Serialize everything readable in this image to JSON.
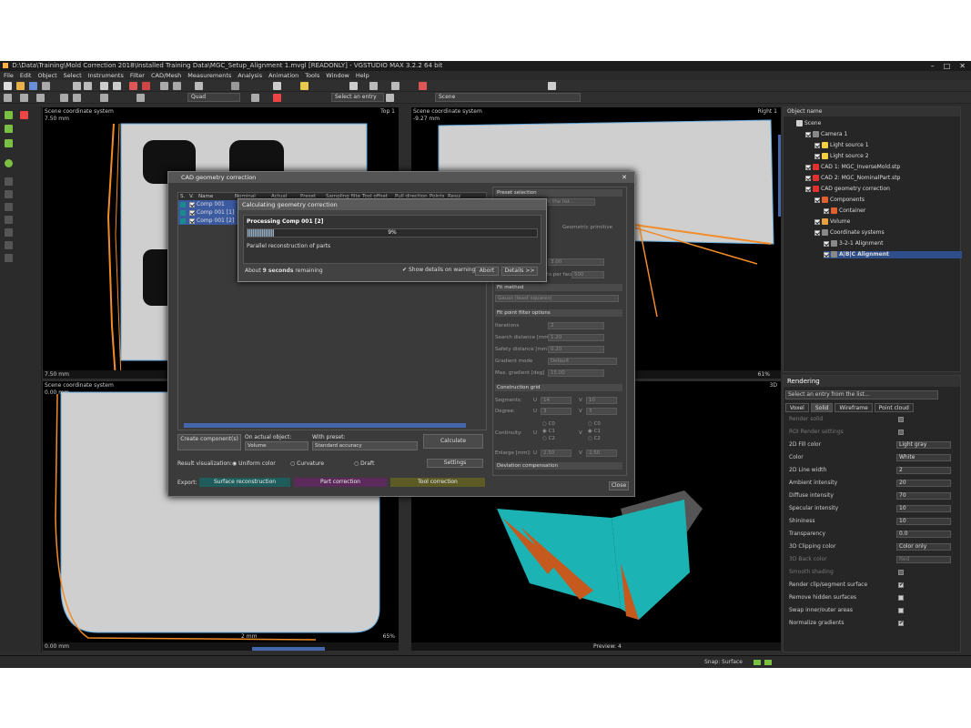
{
  "window": {
    "title": "D:\\Data\\Training\\Mold Correction 2018\\Installed Training Data\\MGC_Setup_Alignment 1.mvgl [READONLY] - VGSTUDIO MAX 3.2.2 64 bit"
  },
  "menu": [
    "File",
    "Edit",
    "Object",
    "Select",
    "Instruments",
    "Filter",
    "CAD/Mesh",
    "Measurements",
    "Analysis",
    "Animation",
    "Tools",
    "Window",
    "Help"
  ],
  "toolbar": {
    "quad_combo": "Quad",
    "entry_combo": "Select an entry",
    "scene_combo": "Scene"
  },
  "viewports": {
    "top_left": {
      "label": "Scene coordinate system",
      "value": "7.50 mm",
      "name": "Top 1",
      "footer_value": "7.50 mm"
    },
    "top_right": {
      "label": "Scene coordinate system",
      "value": "-9.27 mm",
      "name": "Right 1",
      "zoom": "61%"
    },
    "bottom_left": {
      "label": "Scene coordinate system",
      "value": "0.00 mm",
      "footer_value": "0.00 mm",
      "zoom": "65%",
      "scale": "2 mm"
    },
    "bottom_right": {
      "name": "3D",
      "preview": "Preview:",
      "preview_value": "4"
    }
  },
  "object_panel": {
    "header": "Object name",
    "items": [
      {
        "label": "Scene",
        "indent": 0
      },
      {
        "label": "Camera 1",
        "indent": 1
      },
      {
        "label": "Light source 1",
        "indent": 2
      },
      {
        "label": "Light source 2",
        "indent": 2
      },
      {
        "label": "CAD 1: MGC_InverseMold.stp",
        "indent": 1
      },
      {
        "label": "CAD 2: MGC_NominalPart.stp",
        "indent": 1
      },
      {
        "label": "CAD geometry correction",
        "indent": 1
      },
      {
        "label": "Components",
        "indent": 2
      },
      {
        "label": "Container",
        "indent": 3
      },
      {
        "label": "Volume",
        "indent": 2
      },
      {
        "label": "Coordinate systems",
        "indent": 2
      },
      {
        "label": "3-2-1 Alignment",
        "indent": 3
      },
      {
        "label": "A|B|C Alignment",
        "indent": 3
      }
    ]
  },
  "rendering": {
    "title": "Rendering",
    "entry_placeholder": "Select an entry from the list...",
    "tabs": [
      "Voxel",
      "Solid",
      "Wireframe",
      "Point cloud"
    ],
    "active_tab": "Solid",
    "rows": [
      {
        "label": "Render solid",
        "type": "check",
        "value": "",
        "dim": true
      },
      {
        "label": "ROI Render settings",
        "type": "check",
        "value": "",
        "dim": true
      },
      {
        "label": "2D Fill color",
        "type": "combo",
        "value": "Light gray"
      },
      {
        "label": "Color",
        "type": "combo",
        "value": "White"
      },
      {
        "label": "2D Line width",
        "type": "spin",
        "value": "2"
      },
      {
        "label": "Ambient intensity",
        "type": "spin",
        "value": "20"
      },
      {
        "label": "Diffuse intensity",
        "type": "spin",
        "value": "70"
      },
      {
        "label": "Specular intensity",
        "type": "spin",
        "value": "10"
      },
      {
        "label": "Shininess",
        "type": "spin",
        "value": "10"
      },
      {
        "label": "Transparency",
        "type": "spin",
        "value": "0.0"
      },
      {
        "label": "3D Clipping color",
        "type": "combo",
        "value": "Color only"
      },
      {
        "label": "3D Back color",
        "type": "combo",
        "value": "Red",
        "dim": true
      },
      {
        "label": "Smooth shading",
        "type": "check",
        "value": "",
        "dim": true
      },
      {
        "label": "Render clip/segment surface",
        "type": "check",
        "value": "on"
      },
      {
        "label": "Remove hidden surfaces",
        "type": "check",
        "value": ""
      },
      {
        "label": "Swap inner/outer areas",
        "type": "check",
        "value": ""
      },
      {
        "label": "Normalize gradients",
        "type": "check",
        "value": "on"
      }
    ]
  },
  "status": {
    "snap": "Snap: Surface"
  },
  "dialog": {
    "title": "CAD geometry correction",
    "columns": [
      "S.",
      "V.",
      "Name",
      "Nominal",
      "Actual",
      "Preset",
      "Sampling filter",
      "Tool offset",
      "Pull direction",
      "Points",
      "Resul"
    ],
    "rows": [
      "Comp 001",
      "Comp 001 [1]",
      "Comp 001 [2]"
    ],
    "create_button": "Create component(s)",
    "on_actual_label": "On actual object:",
    "on_actual_value": "Volume",
    "with_preset_label": "With preset:",
    "with_preset_value": "Standard accuracy",
    "calculate_button": "Calculate",
    "result_label": "Result visualization:",
    "result_options": [
      "Uniform color",
      "Curvature",
      "Draft"
    ],
    "settings_button": "Settings",
    "export_label": "Export:",
    "export_buttons": [
      "Surface reconstruction",
      "Part correction",
      "Tool correction"
    ],
    "close_button": "Close",
    "right": {
      "preset_selection": "Preset selection",
      "preset_placeholder": "Select an entry from the list...",
      "geometric_primitive": "Geometric primitive",
      "max_num_points": "Max. number of points per face",
      "max_num_points_value": "500",
      "fit_row_value": "3.00",
      "fit_method": "Fit method",
      "fit_method_value": "Gauss (least squares)",
      "fit_point_filter": "Fit point filter options",
      "iterations": "Iterations",
      "iterations_value": "2",
      "search_distance": "Search distance [mm]",
      "search_distance_value": "1.20",
      "safety_distance": "Safety distance [mm]",
      "safety_distance_value": "0.20",
      "gradient_mode": "Gradient mode",
      "gradient_mode_value": "Default",
      "max_gradient": "Max. gradient [deg]",
      "max_gradient_value": "15.00",
      "construction_grid": "Construction grid",
      "segments": "Segments:",
      "segments_u": "14",
      "segments_v": "10",
      "degree": "Degree:",
      "degree_u": "3",
      "degree_v": "3",
      "continuity": "Continuity:",
      "cont_options": [
        "C0",
        "C1",
        "C2"
      ],
      "enlarge": "Enlarge [mm]:",
      "enlarge_u": "2.50",
      "enlarge_v": "2.50",
      "deviation_compensation": "Deviation compensation",
      "u_label": "U",
      "v_label": "V"
    }
  },
  "progress": {
    "title": "Calculating geometry correction",
    "processing": "Processing Comp 001 [2]",
    "percent": "9%",
    "fraction": 0.09,
    "message": "Parallel reconstruction of parts",
    "remaining_prefix": "About",
    "remaining_value": "9 seconds",
    "remaining_suffix": "remaining",
    "show_details": "Show details on warnings",
    "abort_button": "Abort",
    "details_button": "Details >>"
  }
}
